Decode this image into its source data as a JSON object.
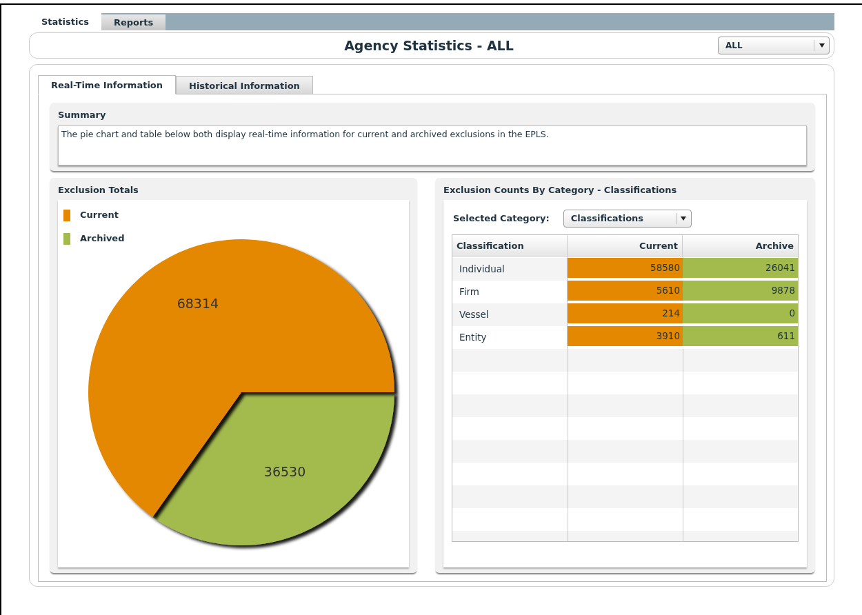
{
  "top_tabs": [
    {
      "label": "Statistics",
      "selected": true
    },
    {
      "label": "Reports",
      "selected": false
    }
  ],
  "header": {
    "title": "Agency Statistics - ALL",
    "agency_select": {
      "value": "ALL"
    }
  },
  "inner_tabs": [
    {
      "label": "Real-Time Information",
      "selected": true
    },
    {
      "label": "Historical Information",
      "selected": false
    }
  ],
  "summary": {
    "title": "Summary",
    "text": "The pie chart and table below both display real-time information for current and archived exclusions in the EPLS."
  },
  "totals": {
    "title": "Exclusion Totals",
    "chart_data": {
      "type": "pie",
      "categories": [
        "Current",
        "Archived"
      ],
      "values": [
        68314,
        36530
      ],
      "colors": [
        "#e38800",
        "#a3bb4d"
      ],
      "data_labels": true
    }
  },
  "counts": {
    "title": "Exclusion Counts By Category - Classifications",
    "category_label": "Selected Category:",
    "category_select": {
      "value": "Classifications"
    },
    "table": {
      "columns": [
        {
          "label": "Classification"
        },
        {
          "label": "Current",
          "color": "#e38800"
        },
        {
          "label": "Archive",
          "color": "#a3bb4d"
        }
      ],
      "rows": [
        [
          "Individual",
          "58580",
          "26041"
        ],
        [
          "Firm",
          "5610",
          "9878"
        ],
        [
          "Vessel",
          "214",
          "0"
        ],
        [
          "Entity",
          "3910",
          "611"
        ]
      ]
    }
  }
}
